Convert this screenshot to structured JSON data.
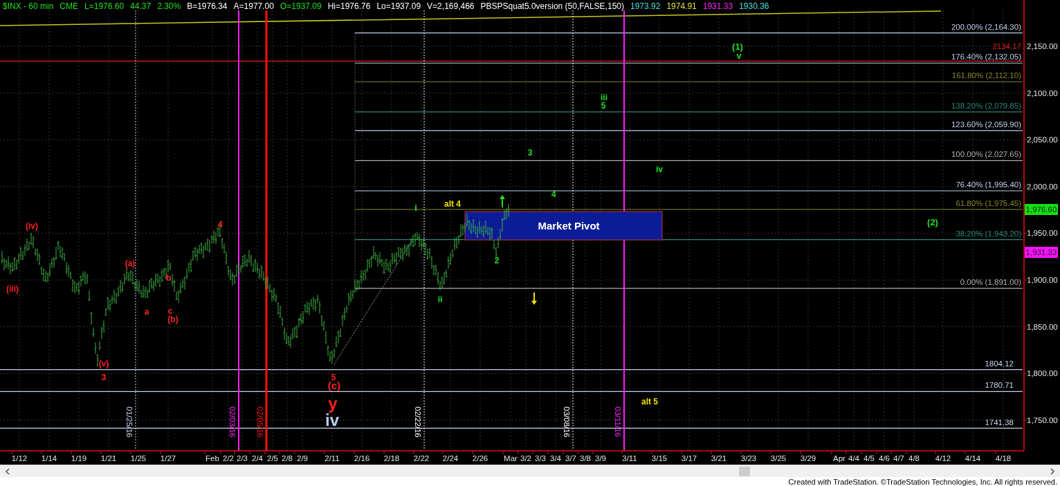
{
  "header": [
    {
      "text": "$INX - 60 min",
      "color": "#20e020"
    },
    {
      "text": "CME",
      "color": "#20e020"
    },
    {
      "text": "L=1976.60",
      "color": "#20e020"
    },
    {
      "text": "44.37",
      "color": "#20e020"
    },
    {
      "text": "2.30%",
      "color": "#20e020"
    },
    {
      "text": "B=1976.34",
      "color": "#ffffff"
    },
    {
      "text": "A=1977.00",
      "color": "#ffffff"
    },
    {
      "text": "O=1937.09",
      "color": "#20e020"
    },
    {
      "text": "Hi=1976.76",
      "color": "#ffffff"
    },
    {
      "text": "Lo=1937.09",
      "color": "#ffffff"
    },
    {
      "text": "V=2,169,466",
      "color": "#ffffff"
    },
    {
      "text": "PBSPSquat5.0version (50,FALSE,150)",
      "color": "#ffffff"
    },
    {
      "text": "1973.92",
      "color": "#40e0e0"
    },
    {
      "text": "1974.91",
      "color": "#e0e040"
    },
    {
      "text": "1931.33",
      "color": "#ff20ff"
    },
    {
      "text": "1930.36",
      "color": "#40e0e0"
    }
  ],
  "price_axis": [
    "2,150.00",
    "2,100.00",
    "2,050.00",
    "2,000.00",
    "1,950.00",
    "1,900.00",
    "1,850.00",
    "1,800.00",
    "1,750.00"
  ],
  "date_axis": [
    "1/12",
    "1/14",
    "1/19",
    "1/21",
    "1/25",
    "1/27",
    "Feb",
    "2/2",
    "2/3",
    "2/4",
    "2/5",
    "2/8",
    "2/9",
    "2/11",
    "2/16",
    "2/18",
    "2/22",
    "2/24",
    "2/26",
    "Mar",
    "3/2",
    "3/3",
    "3/4",
    "3/7",
    "3/8",
    "3/9",
    "3/11",
    "3/15",
    "3/17",
    "3/21",
    "3/23",
    "3/25",
    "3/29",
    "Apr",
    "4/4",
    "4/5",
    "4/6",
    "4/7",
    "4/8",
    "4/12",
    "4/14",
    "4/18"
  ],
  "fib_levels": [
    {
      "label": "200.00% (2,164.30)",
      "color": "#c0d0ee"
    },
    {
      "label": "176.40% (2,132.05)",
      "color": "#c0d0ee"
    },
    {
      "label": "161.80% (2,112.10)",
      "color": "#8a8a28"
    },
    {
      "label": "138.20% (2,079.85)",
      "color": "#2a8a80"
    },
    {
      "label": "123.60% (2,059.90)",
      "color": "#c0d0ee"
    },
    {
      "label": "100.00% (2,027.65)",
      "color": "#b0b0b0"
    },
    {
      "label": "76.40% (1,995.40)",
      "color": "#c0d0ee"
    },
    {
      "label": "61.80% (1,975.45)",
      "color": "#8a8a28"
    },
    {
      "label": "38.20% (1,943.20)",
      "color": "#2a8a80"
    },
    {
      "label": "0.00% (1,891.00)",
      "color": "#b0b0b0"
    }
  ],
  "price_levels": [
    {
      "label": "2134.17",
      "color": "#e02020"
    },
    {
      "label": "1804.12",
      "color": "#c8d4ee"
    },
    {
      "label": "1780.71",
      "color": "#c8d4ee"
    },
    {
      "label": "1741.38",
      "color": "#c8d4ee"
    }
  ],
  "date_markers": [
    {
      "label": "01/25/16",
      "color": "#c8d8f0",
      "kind": "dotted"
    },
    {
      "label": "02/03/16",
      "color": "#ff20ff",
      "kind": "solid"
    },
    {
      "label": "02/05/16",
      "color": "#ff1010",
      "kind": "thick"
    },
    {
      "label": "02/22/16",
      "color": "#ffffff",
      "kind": "dotted"
    },
    {
      "label": "03/08/16",
      "color": "#ffffff",
      "kind": "dotted"
    },
    {
      "label": "03/11/16",
      "color": "#ff20ff",
      "kind": "solid"
    }
  ],
  "pivot_zone": {
    "label": "Market Pivot"
  },
  "wave_labels": [
    {
      "text": "(iv)",
      "color": "#ff2020"
    },
    {
      "text": "(iii)",
      "color": "#ff2020"
    },
    {
      "text": "(v)",
      "color": "#ff2020"
    },
    {
      "text": "3",
      "color": "#ff2020"
    },
    {
      "text": "(a)",
      "color": "#ff2020"
    },
    {
      "text": "a",
      "color": "#ff2020"
    },
    {
      "text": "b",
      "color": "#ff2020"
    },
    {
      "text": "c",
      "color": "#ff2020"
    },
    {
      "text": "(b)",
      "color": "#ff2020"
    },
    {
      "text": "4",
      "color": "#ff2020"
    },
    {
      "text": "5",
      "color": "#ff2020"
    },
    {
      "text": "(c)",
      "color": "#ff2020"
    },
    {
      "text": "y",
      "color": "#ff2020"
    },
    {
      "text": "iv",
      "color": "#b8ccee"
    },
    {
      "text": "i",
      "color": "#20e020"
    },
    {
      "text": "ii",
      "color": "#20e020"
    },
    {
      "text": "2",
      "color": "#20e020"
    },
    {
      "text": "alt 4",
      "color": "#f0e000"
    },
    {
      "text": "3",
      "color": "#20e020"
    },
    {
      "text": "4",
      "color": "#20e020"
    },
    {
      "text": "iii",
      "color": "#20e020"
    },
    {
      "text": "5",
      "color": "#20e020"
    },
    {
      "text": "iv",
      "color": "#20e020"
    },
    {
      "text": "(1)",
      "color": "#20e020"
    },
    {
      "text": "v",
      "color": "#20e020"
    },
    {
      "text": "(2)",
      "color": "#20e020"
    },
    {
      "text": "alt 5",
      "color": "#f0e000"
    }
  ],
  "arrows": [
    {
      "kind": "up",
      "color": "#20e020"
    },
    {
      "kind": "down",
      "color": "#f0e000"
    }
  ],
  "price_badges": [
    {
      "text": "1,976.60",
      "color": "#10e010"
    },
    {
      "text": "1,931.33",
      "color": "#ff10ff"
    }
  ],
  "footer": "Created with TradeStation. ©TradeStation Technologies, Inc. All rights reserved."
}
